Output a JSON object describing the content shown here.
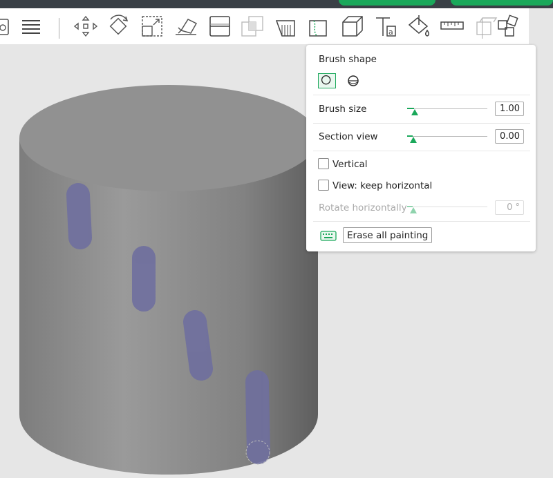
{
  "toolbar": {
    "icons": [
      "clipboard-icon",
      "layers-list-icon",
      "move-icon",
      "rotate-icon",
      "scale-icon",
      "lay-on-face-icon",
      "cut-icon",
      "boolean-icon",
      "support-painting-icon",
      "seam-painting-icon",
      "variable-layer-height-icon",
      "text-icon",
      "color-painting-icon",
      "measure-icon",
      "assembly-icon",
      "arrange-icon"
    ]
  },
  "colors": {
    "accent": "#1aa85a",
    "paint": "#6f6f9e",
    "model": "#8a8a8a"
  },
  "brush_panel": {
    "brush_shape_label": "Brush shape",
    "shapes": [
      "circle-icon",
      "sphere-icon"
    ],
    "brush_size_label": "Brush size",
    "brush_size_value": "1.00",
    "brush_size_level": 0.02,
    "section_view_label": "Section view",
    "section_view_value": "0.00",
    "section_view_level": 0.0,
    "vertical_label": "Vertical",
    "keep_horizontal_label": "View: keep horizontal",
    "rotate_label": "Rotate horizontally",
    "rotate_value": "0 °",
    "rotate_level": 0.0,
    "erase_label": "Erase all painting"
  }
}
